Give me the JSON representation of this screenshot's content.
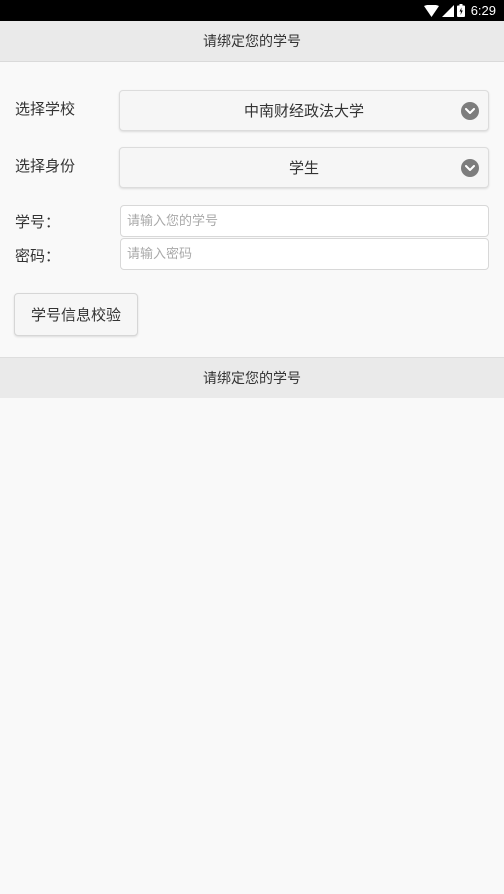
{
  "status_bar": {
    "time": "6:29",
    "icons": [
      "wifi-icon",
      "signal-icon",
      "battery-icon"
    ]
  },
  "header": {
    "title": "请绑定您的学号"
  },
  "form": {
    "school": {
      "label": "选择学校",
      "value": "中南财经政法大学"
    },
    "identity": {
      "label": "选择身份",
      "value": "学生"
    },
    "student_id": {
      "label": "学号：",
      "placeholder": "请输入您的学号"
    },
    "password": {
      "label": "密码：",
      "placeholder": "请输入密码"
    },
    "verify_button": "学号信息校验"
  },
  "footer_bar": {
    "title": "请绑定您的学号"
  },
  "colors": {
    "background": "#f9f9f9",
    "header_bg": "#eaeaea",
    "status_bar_bg": "#000000",
    "chevron": "#7d7d7d",
    "placeholder": "#a9a9a9"
  }
}
